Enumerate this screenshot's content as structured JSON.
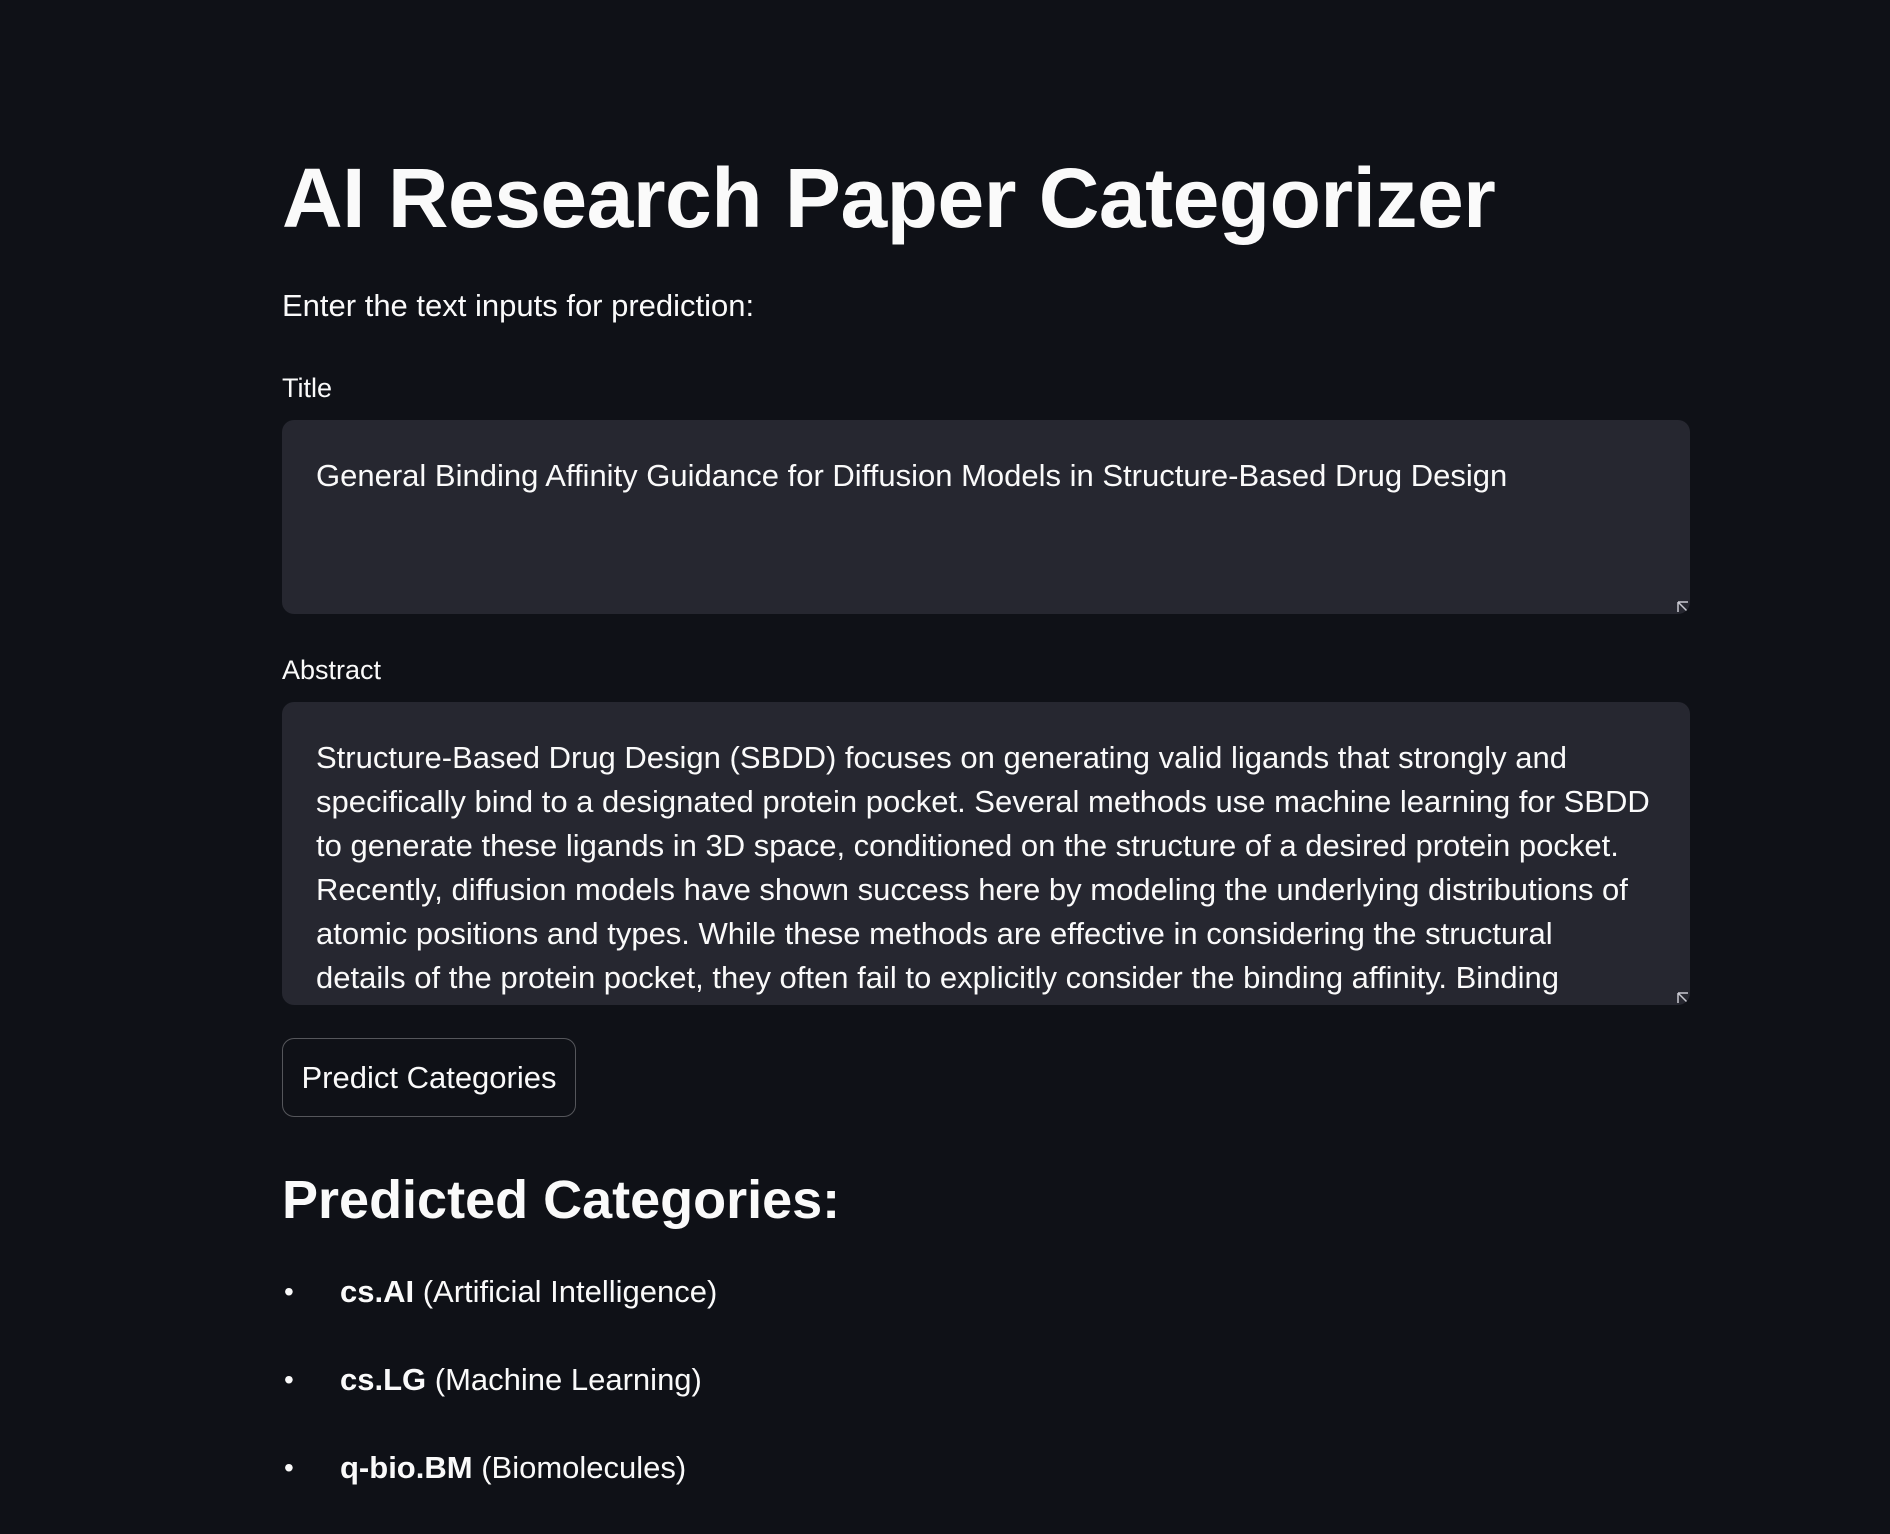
{
  "app": {
    "title": "AI Research Paper Categorizer",
    "intro": "Enter the text inputs for prediction:"
  },
  "form": {
    "title_label": "Title",
    "title_value": "General Binding Affinity Guidance for Diffusion Models in Structure-Based Drug Design",
    "abstract_label": "Abstract",
    "abstract_value": "Structure-Based Drug Design (SBDD) focuses on generating valid ligands that strongly and specifically bind to a designated protein pocket. Several methods use machine learning for SBDD to generate these ligands in 3D space, conditioned on the structure of a desired protein pocket. Recently, diffusion models have shown success here by modeling the underlying distributions of atomic positions and types. While these methods are effective in considering the structural details of the protein pocket, they often fail to explicitly consider the binding affinity. Binding affinity",
    "predict_label": "Predict Categories"
  },
  "results": {
    "heading": "Predicted Categories:",
    "bullet": "•",
    "items": [
      {
        "code": "cs.AI",
        "description": "(Artificial Intelligence)"
      },
      {
        "code": "cs.LG",
        "description": "(Machine Learning)"
      },
      {
        "code": "q-bio.BM",
        "description": "(Biomolecules)"
      }
    ]
  },
  "icons": {
    "resize_handle": "resize-grip-icon",
    "bullet": "bullet-icon"
  },
  "colors": {
    "background": "#0f1117",
    "input_background": "#262730",
    "text": "#fafafa"
  }
}
